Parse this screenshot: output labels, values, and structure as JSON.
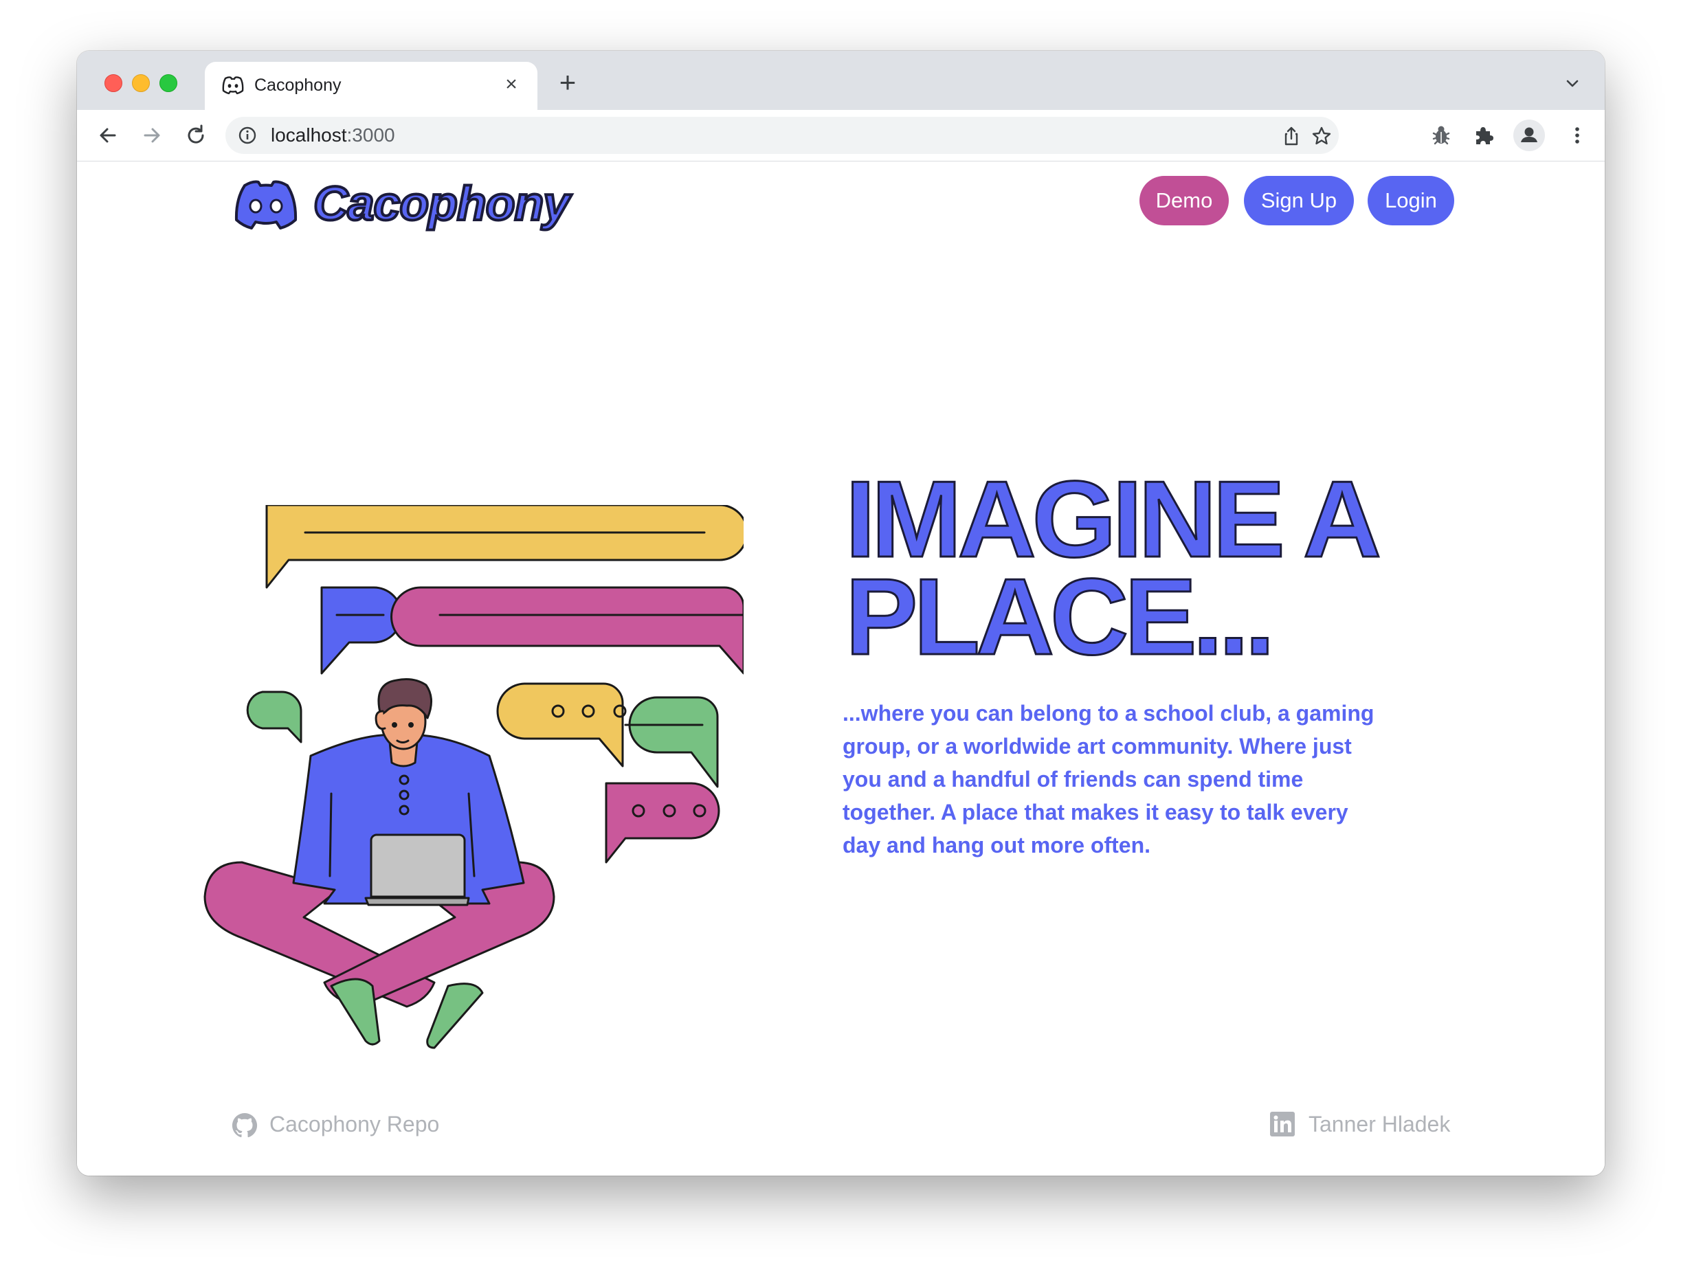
{
  "browser": {
    "tab_title": "Cacophony",
    "tab_close": "×",
    "new_tab": "+",
    "url_host": "localhost",
    "url_port": ":3000"
  },
  "header": {
    "logo_text": "Cacophony",
    "buttons": {
      "demo": "Demo",
      "signup": "Sign Up",
      "login": "Login"
    }
  },
  "hero": {
    "headline_line1": "IMAGINE A",
    "headline_line2": "PLACE...",
    "body": "...where you can belong to a school club, a gaming group, or a worldwide art community. Where just you and a handful of friends can spend time together. A place that makes it easy to talk every day and hang out more often."
  },
  "footer": {
    "repo_label": "Cacophony Repo",
    "linkedin_label": "Tanner Hladek"
  },
  "colors": {
    "brand": "#5865f2",
    "demo": "#c14f96",
    "bubble_yellow": "#f0c75e",
    "bubble_pink": "#c9589b",
    "bubble_green": "#77c182",
    "footer_text": "#b0b3b8"
  }
}
